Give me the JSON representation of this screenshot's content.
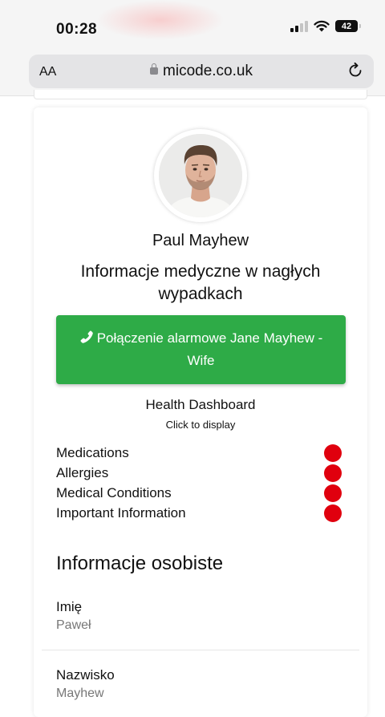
{
  "status_bar": {
    "time": "00:28",
    "battery": "42"
  },
  "browser": {
    "text_size_label": "AA",
    "domain": "micode.co.uk"
  },
  "profile": {
    "name": "Paul Mayhew",
    "subtitle": "Informacje medyczne w nagłych wypadkach"
  },
  "call_button": {
    "label": "Połączenie alarmowe Jane Mayhew - Wife",
    "color": "#2eab47"
  },
  "health_dashboard": {
    "title": "Health Dashboard",
    "hint": "Click to display",
    "indicator_color": "#e0000e",
    "items": [
      {
        "label": "Medications"
      },
      {
        "label": "Allergies"
      },
      {
        "label": "Medical Conditions"
      },
      {
        "label": "Important Information"
      }
    ]
  },
  "personal_info": {
    "title": "Informacje osobiste",
    "fields": [
      {
        "label": "Imię",
        "value": "Paweł"
      },
      {
        "label": "Nazwisko",
        "value": "Mayhew"
      }
    ]
  },
  "icons": {
    "phone": "phone-icon",
    "lock": "lock-icon",
    "reload": "reload-icon",
    "wifi": "wifi-icon",
    "signal": "cellular-signal-icon",
    "battery": "battery-icon"
  }
}
